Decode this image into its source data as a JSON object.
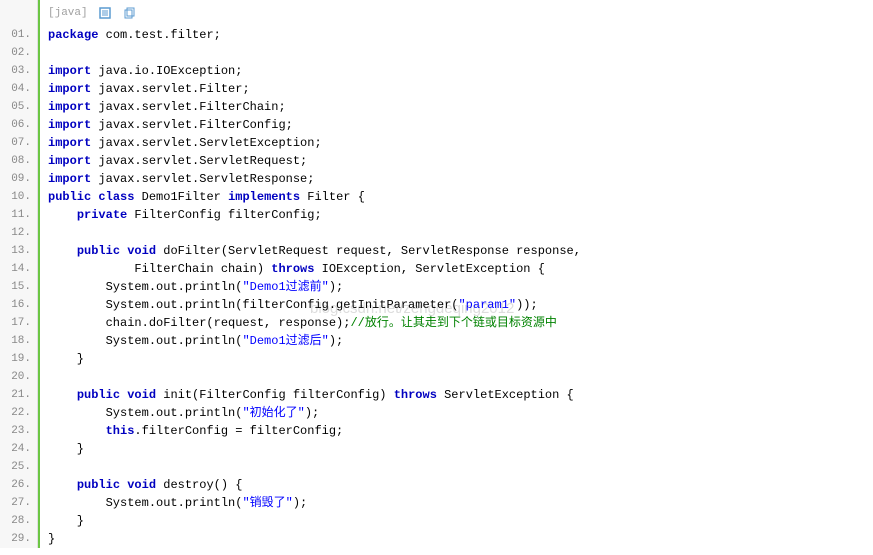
{
  "header": {
    "lang_label": "[java]",
    "view_plain_title": "view plain",
    "copy_title": "copy"
  },
  "watermark": "blog.csdn.net/zengdeqing2012",
  "gutter": [
    "01.",
    "02.",
    "03.",
    "04.",
    "05.",
    "06.",
    "07.",
    "08.",
    "09.",
    "10.",
    "11.",
    "12.",
    "13.",
    "14.",
    "15.",
    "16.",
    "17.",
    "18.",
    "19.",
    "20.",
    "21.",
    "22.",
    "23.",
    "24.",
    "25.",
    "26.",
    "27.",
    "28.",
    "29."
  ],
  "tokens": {
    "package": "package",
    "import": "import",
    "public": "public",
    "class": "class",
    "implements": "implements",
    "private": "private",
    "void": "void",
    "throws": "throws",
    "this": "this"
  },
  "code": {
    "l1_pkg": " com.test.filter;",
    "l3": " java.io.IOException;",
    "l4": " javax.servlet.Filter;",
    "l5": " javax.servlet.FilterChain;",
    "l6": " javax.servlet.FilterConfig;",
    "l7": " javax.servlet.ServletException;",
    "l8": " javax.servlet.ServletRequest;",
    "l9": " javax.servlet.ServletResponse;",
    "l10a": " Demo1Filter ",
    "l10b": " Filter {",
    "l11": " FilterConfig filterConfig;",
    "l13a": " doFilter(ServletRequest request, ServletResponse response,",
    "l14a": "            FilterChain chain) ",
    "l14b": " IOException, ServletException {",
    "l15a": "        System.out.println(",
    "l15s": "\"Demo1过滤前\"",
    "l15b": ");",
    "l16a": "        System.out.println(filterConfig.getInitParameter(",
    "l16s": "\"param1\"",
    "l16b": "));",
    "l17a": "        chain.doFilter(request, response);",
    "l17c": "//放行。让其走到下个链或目标资源中",
    "l18a": "        System.out.println(",
    "l18s": "\"Demo1过滤后\"",
    "l18b": ");",
    "l19": "    }",
    "l21a": " init(FilterConfig filterConfig) ",
    "l21b": " ServletException {",
    "l22a": "        System.out.println(",
    "l22s": "\"初始化了\"",
    "l22b": ");",
    "l23a": ".filterConfig = filterConfig;",
    "l24": "    }",
    "l26a": " destroy() {",
    "l27a": "        System.out.println(",
    "l27s": "\"销毁了\"",
    "l27b": ");",
    "l28": "    }",
    "l29": "}"
  }
}
